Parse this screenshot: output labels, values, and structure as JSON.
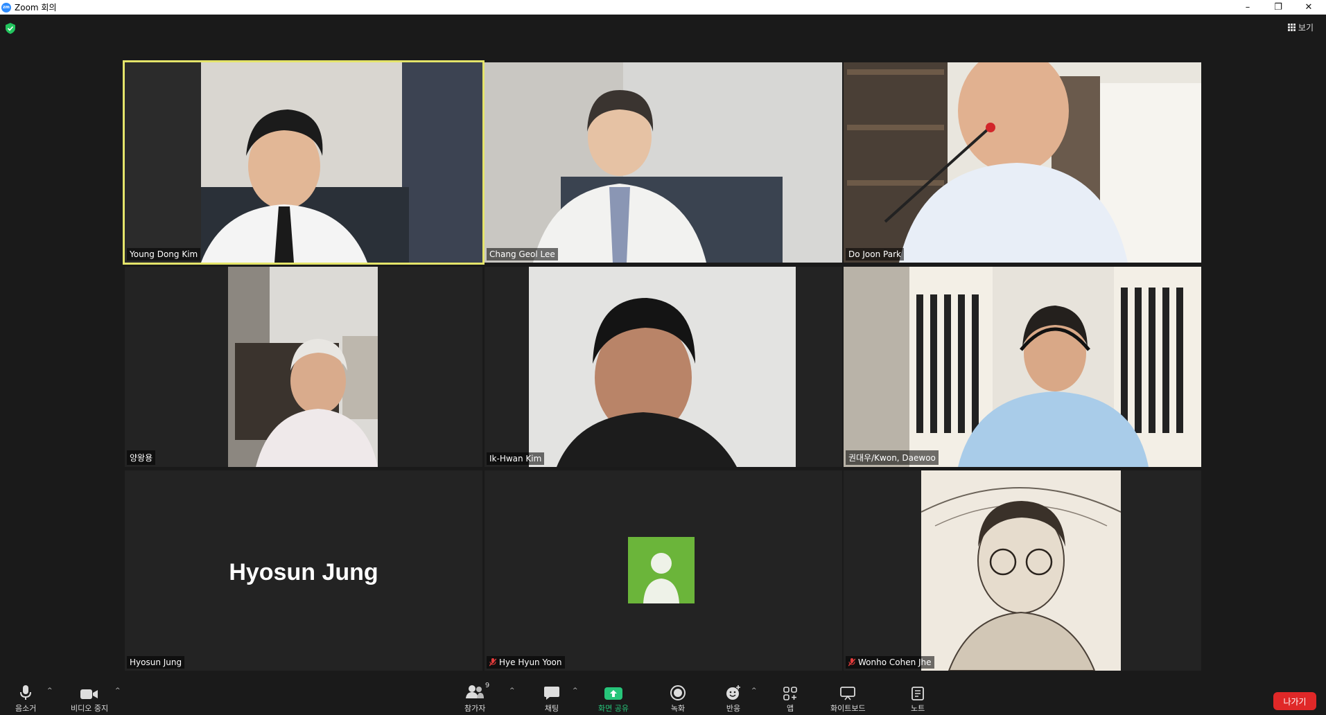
{
  "window": {
    "title": "Zoom 회의",
    "minimize": "–",
    "restore": "❐",
    "close": "✕"
  },
  "header": {
    "view_label": "보기"
  },
  "participants": [
    {
      "name": "Young Dong Kim",
      "video": true,
      "active_speaker": true,
      "muted": false
    },
    {
      "name": "Chang Geol Lee",
      "video": true,
      "muted": false
    },
    {
      "name": "Do Joon Park",
      "video": true,
      "muted": false
    },
    {
      "name": "양왕용",
      "video": true,
      "muted": false
    },
    {
      "name": "Ik-Hwan Kim",
      "video": true,
      "muted": false
    },
    {
      "name": "권대우/Kwon, Daewoo",
      "video": true,
      "muted": false
    },
    {
      "name": "Hyosun Jung",
      "display_name": "Hyosun Jung",
      "video": false,
      "muted": false
    },
    {
      "name": "Hye Hyun Yoon",
      "video": false,
      "avatar": "default-avatar",
      "muted": true
    },
    {
      "name": "Wonho Cohen Jhe",
      "video": true,
      "muted": true
    }
  ],
  "toolbar": {
    "mute_label": "음소거",
    "video_label": "비디오 중지",
    "participants_label": "참가자",
    "participants_count": "9",
    "chat_label": "채팅",
    "share_label": "화면 공유",
    "record_label": "녹화",
    "reactions_label": "반응",
    "apps_label": "앱",
    "whiteboard_label": "화이트보드",
    "notes_label": "노트",
    "leave_label": "나가기"
  },
  "colors": {
    "active_speaker": "#e4e46a",
    "share_green": "#27c57a",
    "leave_red": "#e02828",
    "avatar_green": "#6bb53a"
  }
}
